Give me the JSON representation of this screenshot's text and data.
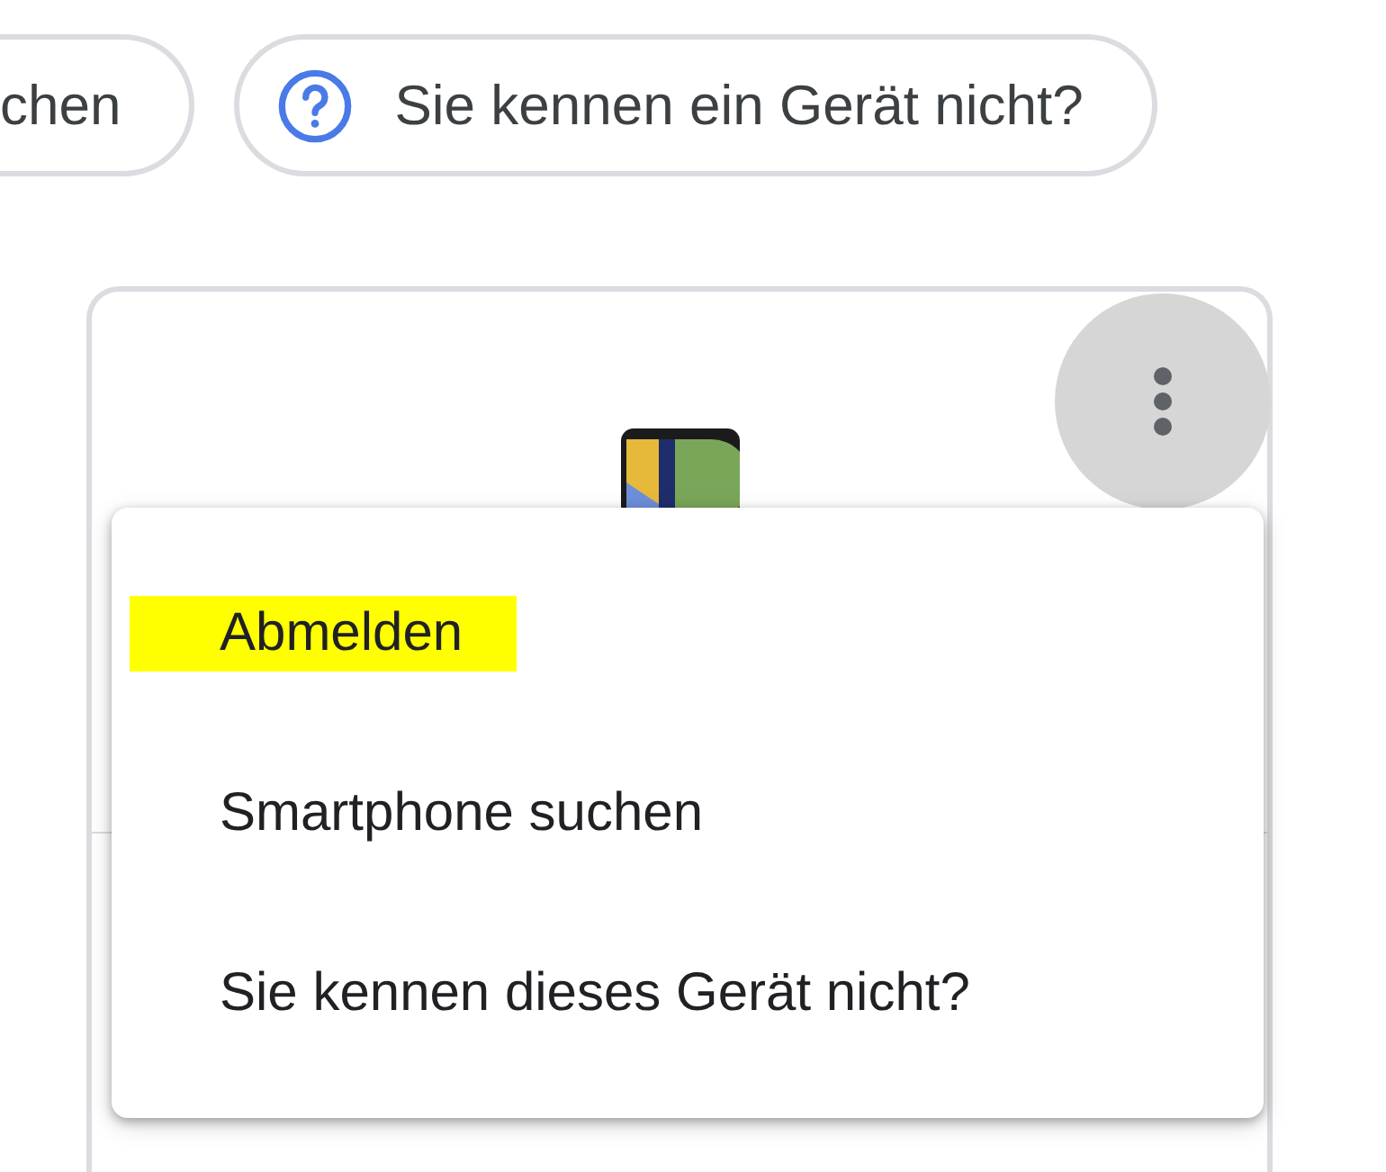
{
  "chips": [
    {
      "label": "chen",
      "kind": "plain"
    },
    {
      "label": "Sie kennen ein Gerät nicht?",
      "kind": "help"
    }
  ],
  "menu": {
    "items": [
      {
        "label": "Abmelden",
        "highlighted": true
      },
      {
        "label": "Smartphone suchen",
        "highlighted": false
      },
      {
        "label": "Sie kennen dieses Gerät nicht?",
        "highlighted": false
      }
    ]
  }
}
